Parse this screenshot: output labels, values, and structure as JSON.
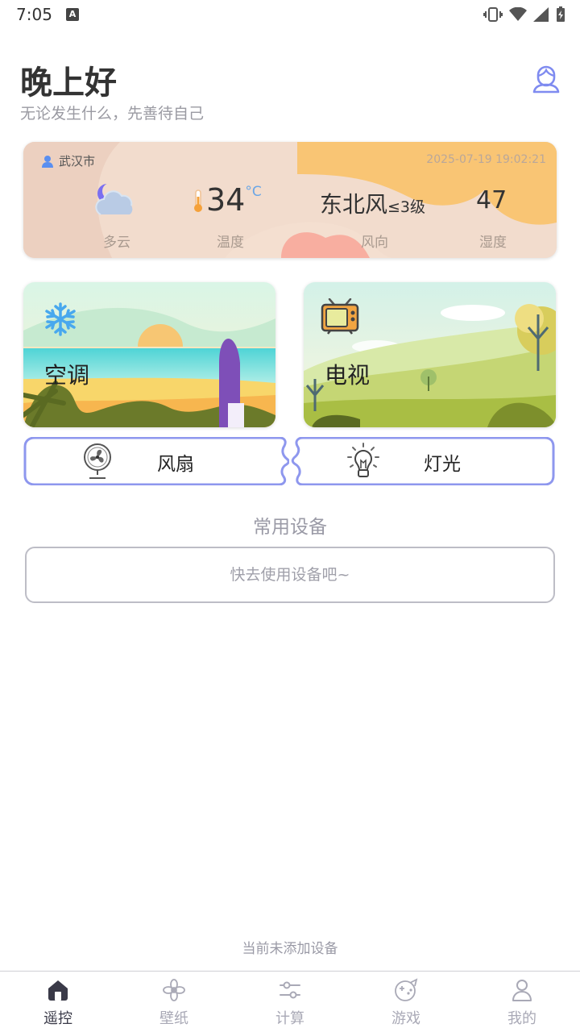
{
  "status_bar": {
    "time": "7:05",
    "notification_icon": "A"
  },
  "header": {
    "greeting": "晚上好",
    "subtitle": "无论发生什么，先善待自己",
    "profile_icon": "user-icon"
  },
  "weather": {
    "city": "武汉市",
    "timestamp": "2025-07-19 19:02:21",
    "condition": "多云",
    "temperature": "34",
    "temperature_unit": "°C",
    "temperature_label": "温度",
    "wind_direction": "东北风",
    "wind_level": "≤3级",
    "wind_label": "风向",
    "humidity": "47",
    "humidity_label": "湿度"
  },
  "devices": {
    "air_conditioner": "空调",
    "tv": "电视",
    "fan": "风扇",
    "light": "灯光"
  },
  "common": {
    "title": "常用设备",
    "empty_prompt": "快去使用设备吧~",
    "empty_note": "当前未添加设备"
  },
  "tabbar": {
    "items": [
      {
        "label": "遥控",
        "icon": "home-icon",
        "active": true
      },
      {
        "label": "壁纸",
        "icon": "flower-icon",
        "active": false
      },
      {
        "label": "计算",
        "icon": "sliders-icon",
        "active": false
      },
      {
        "label": "游戏",
        "icon": "gamepad-icon",
        "active": false
      },
      {
        "label": "我的",
        "icon": "user-icon",
        "active": false
      }
    ]
  },
  "colors": {
    "accent": "#7f8bf0",
    "weather_bg": "#f2dccd",
    "weather_blob": "#f9c574",
    "weather_blob_red": "#fb7a6d"
  }
}
